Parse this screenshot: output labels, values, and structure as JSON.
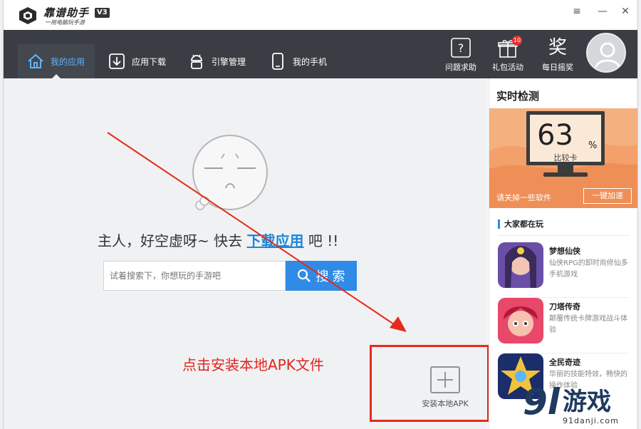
{
  "titlebar": {
    "app_name": "靠谱助手",
    "version": "V3",
    "tagline": "一用电脑玩手游",
    "minimize": "—",
    "menu": "≡",
    "close": "✕"
  },
  "nav": {
    "tabs": [
      {
        "label": "我的应用",
        "active": true
      },
      {
        "label": "应用下载",
        "active": false
      },
      {
        "label": "引擎管理",
        "active": false
      },
      {
        "label": "我的手机",
        "active": false
      }
    ],
    "right_icons": [
      {
        "label": "问题求助",
        "icon": "help-icon"
      },
      {
        "label": "礼包活动",
        "icon": "gift-icon",
        "badge": "10"
      },
      {
        "label": "每日摇奖",
        "icon": "lottery-icon",
        "glyph": "奖"
      }
    ]
  },
  "main": {
    "empty_prefix": "主人，好空虚呀~ 快去 ",
    "empty_link": "下载应用",
    "empty_suffix": " 吧 !!",
    "search_placeholder": "试着搜索下，你想玩的手游吧",
    "search_button": "搜 索",
    "annotation": "点击安装本地APK文件",
    "install_label": "安装本地APK"
  },
  "sidebar": {
    "realtime_title": "实时检测",
    "score": "63",
    "score_unit": "%",
    "score_caption": "比较卡",
    "tip": "请关掉一些软件",
    "accelerate_button": "一键加速",
    "hot_title": "大家都在玩",
    "games": [
      {
        "name": "梦想仙侠",
        "desc": "仙侠RPG的卸时尚修仙多手机游戏"
      },
      {
        "name": "刀塔传奇",
        "desc": "颠覆传统卡牌游戏战斗体验"
      },
      {
        "name": "全民奇迹",
        "desc": "华丽的技能特效，畅快的操作体验"
      }
    ]
  },
  "watermark": {
    "nine": "9l",
    "text": "游戏",
    "domain": "91danji.com"
  },
  "colors": {
    "nav_bg": "#3a3d43",
    "accent": "#2f8be6",
    "annotation_red": "#e0261b",
    "monitor_bg": "#f5b07f"
  }
}
